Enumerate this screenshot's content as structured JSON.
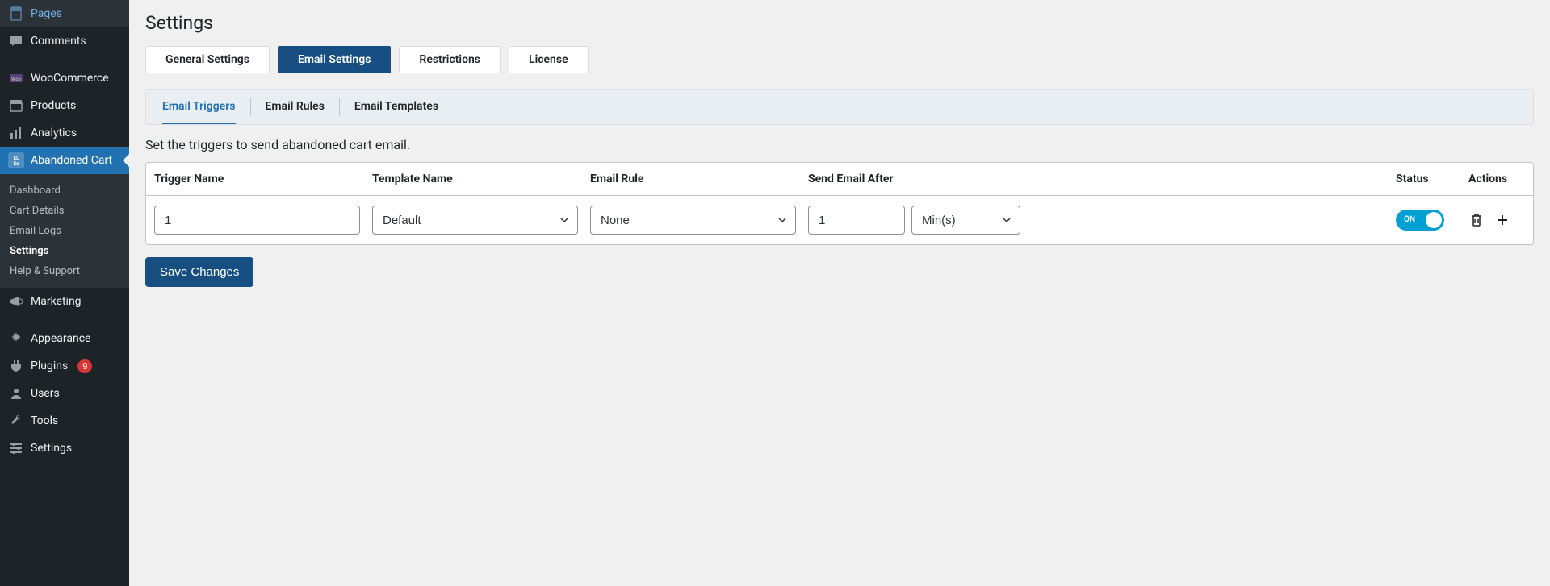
{
  "sidebar": {
    "items": [
      {
        "label": "Pages",
        "icon": "pages"
      },
      {
        "label": "Comments",
        "icon": "comments"
      },
      {
        "label": "WooCommerce",
        "icon": "woo"
      },
      {
        "label": "Products",
        "icon": "products"
      },
      {
        "label": "Analytics",
        "icon": "analytics"
      },
      {
        "label": "Abandoned Cart",
        "icon": "elex",
        "active": true
      },
      {
        "label": "Marketing",
        "icon": "marketing"
      },
      {
        "label": "Appearance",
        "icon": "appearance"
      },
      {
        "label": "Plugins",
        "icon": "plugins",
        "badge": "9"
      },
      {
        "label": "Users",
        "icon": "users"
      },
      {
        "label": "Tools",
        "icon": "tools"
      },
      {
        "label": "Settings",
        "icon": "settings"
      }
    ],
    "submenu": [
      {
        "label": "Dashboard"
      },
      {
        "label": "Cart Details"
      },
      {
        "label": "Email Logs"
      },
      {
        "label": "Settings",
        "active": true
      },
      {
        "label": "Help & Support"
      }
    ]
  },
  "page": {
    "title": "Settings",
    "tabs": [
      {
        "label": "General Settings"
      },
      {
        "label": "Email Settings",
        "active": true
      },
      {
        "label": "Restrictions"
      },
      {
        "label": "License"
      }
    ],
    "subtabs": [
      {
        "label": "Email Triggers",
        "active": true
      },
      {
        "label": "Email Rules"
      },
      {
        "label": "Email Templates"
      }
    ],
    "description": "Set the triggers to send abandoned cart email.",
    "save_label": "Save Changes"
  },
  "table": {
    "headers": {
      "trigger_name": "Trigger Name",
      "template_name": "Template Name",
      "email_rule": "Email Rule",
      "send_after": "Send Email After",
      "status": "Status",
      "actions": "Actions"
    },
    "row": {
      "trigger_name": "1",
      "template_name": "Default",
      "email_rule": "None",
      "send_after_value": "1",
      "send_after_unit": "Min(s)",
      "status_label": "ON"
    }
  }
}
